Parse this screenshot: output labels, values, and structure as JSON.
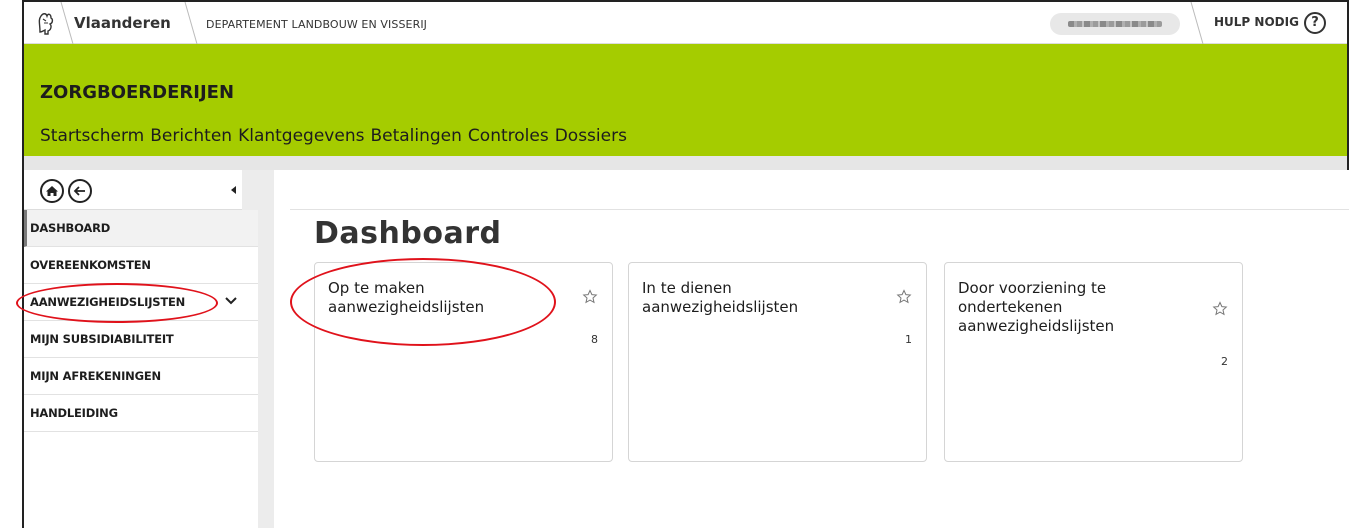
{
  "topbar": {
    "brand": "Vlaanderen",
    "department": "DEPARTEMENT LANDBOUW EN VISSERIJ",
    "help_label": "HULP NODIG",
    "help_icon_glyph": "?"
  },
  "header": {
    "app_title": "ZORGBOERDERIJEN",
    "nav": [
      "Startscherm",
      "Berichten",
      "Klantgegevens",
      "Betalingen",
      "Controles",
      "Dossiers"
    ]
  },
  "sidebar": {
    "items": [
      {
        "label": "DASHBOARD",
        "active": true
      },
      {
        "label": "OVEREENKOMSTEN"
      },
      {
        "label": "AANWEZIGHEIDSLIJSTEN",
        "expandable": true
      },
      {
        "label": "MIJN SUBSIDIABILITEIT"
      },
      {
        "label": "MIJN AFREKENINGEN"
      },
      {
        "label": "HANDLEIDING"
      }
    ]
  },
  "main": {
    "title": "Dashboard",
    "cards": [
      {
        "title": "Op te maken aanwezigheidslijsten",
        "count": "8"
      },
      {
        "title": "In te dienen aanwezigheidslijsten",
        "count": "1"
      },
      {
        "title": "Door voorziening te ondertekenen aanwezigheidslijsten",
        "count": "2"
      }
    ]
  },
  "colors": {
    "brand_green": "#a5cc00",
    "annotation_red": "#e0121b"
  },
  "icons": [
    "vlaanderen-lion-logo",
    "help-icon",
    "home-icon",
    "back-arrow-icon",
    "collapse-caret-icon",
    "chevron-down-icon",
    "star-icon"
  ]
}
